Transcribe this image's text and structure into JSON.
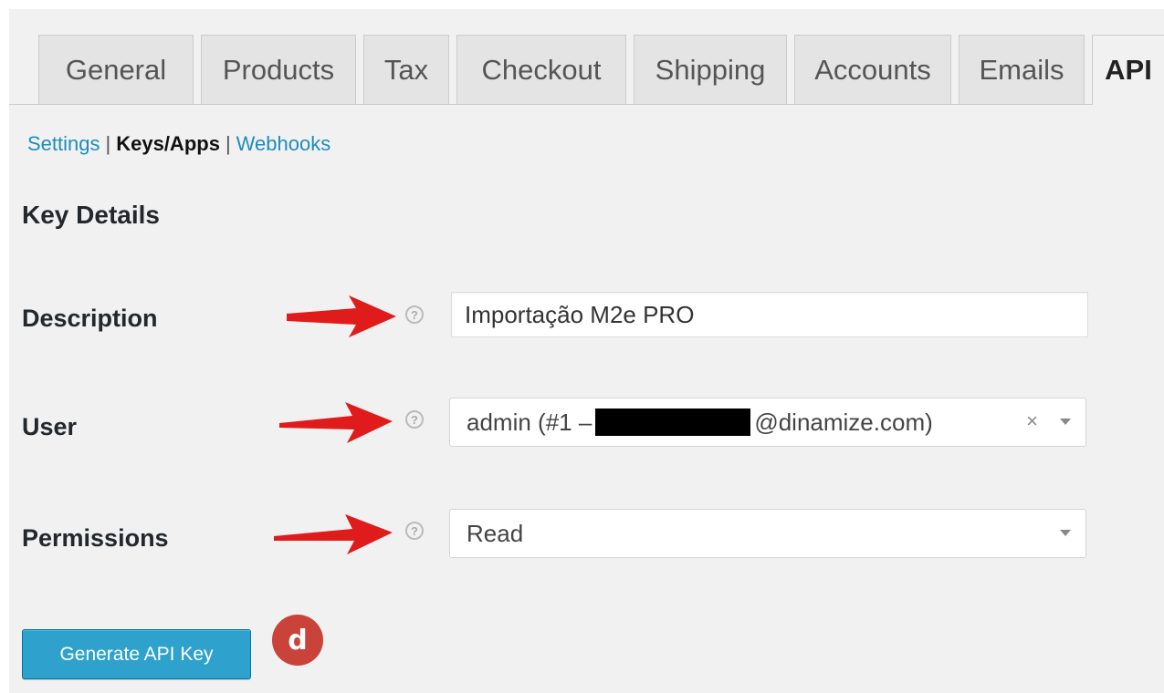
{
  "tabs": [
    {
      "label": "General"
    },
    {
      "label": "Products"
    },
    {
      "label": "Tax"
    },
    {
      "label": "Checkout"
    },
    {
      "label": "Shipping"
    },
    {
      "label": "Accounts"
    },
    {
      "label": "Emails"
    },
    {
      "label": "API"
    }
  ],
  "active_tab": "API",
  "subnav": {
    "settings": "Settings",
    "keys_apps": "Keys/Apps",
    "webhooks": "Webhooks",
    "separator": "|"
  },
  "section_title": "Key Details",
  "form": {
    "description": {
      "label": "Description",
      "value": "Importação M2e PRO"
    },
    "user": {
      "label": "User",
      "value_prefix": "admin (#1 –",
      "value_suffix": "@dinamize.com)",
      "clear": "×"
    },
    "permissions": {
      "label": "Permissions",
      "value": "Read"
    },
    "help_icon": "?"
  },
  "generate_button": "Generate API Key",
  "step_badge": "d",
  "colors": {
    "accent": "#2ea2cc",
    "link": "#1e8cbe",
    "arrow": "#e01b1b",
    "badge": "#c9433a",
    "panel": "#f1f1f1"
  },
  "icons": [
    "help-circle-icon",
    "red-arrow-icon",
    "chevron-down-icon",
    "clear-x-icon"
  ]
}
